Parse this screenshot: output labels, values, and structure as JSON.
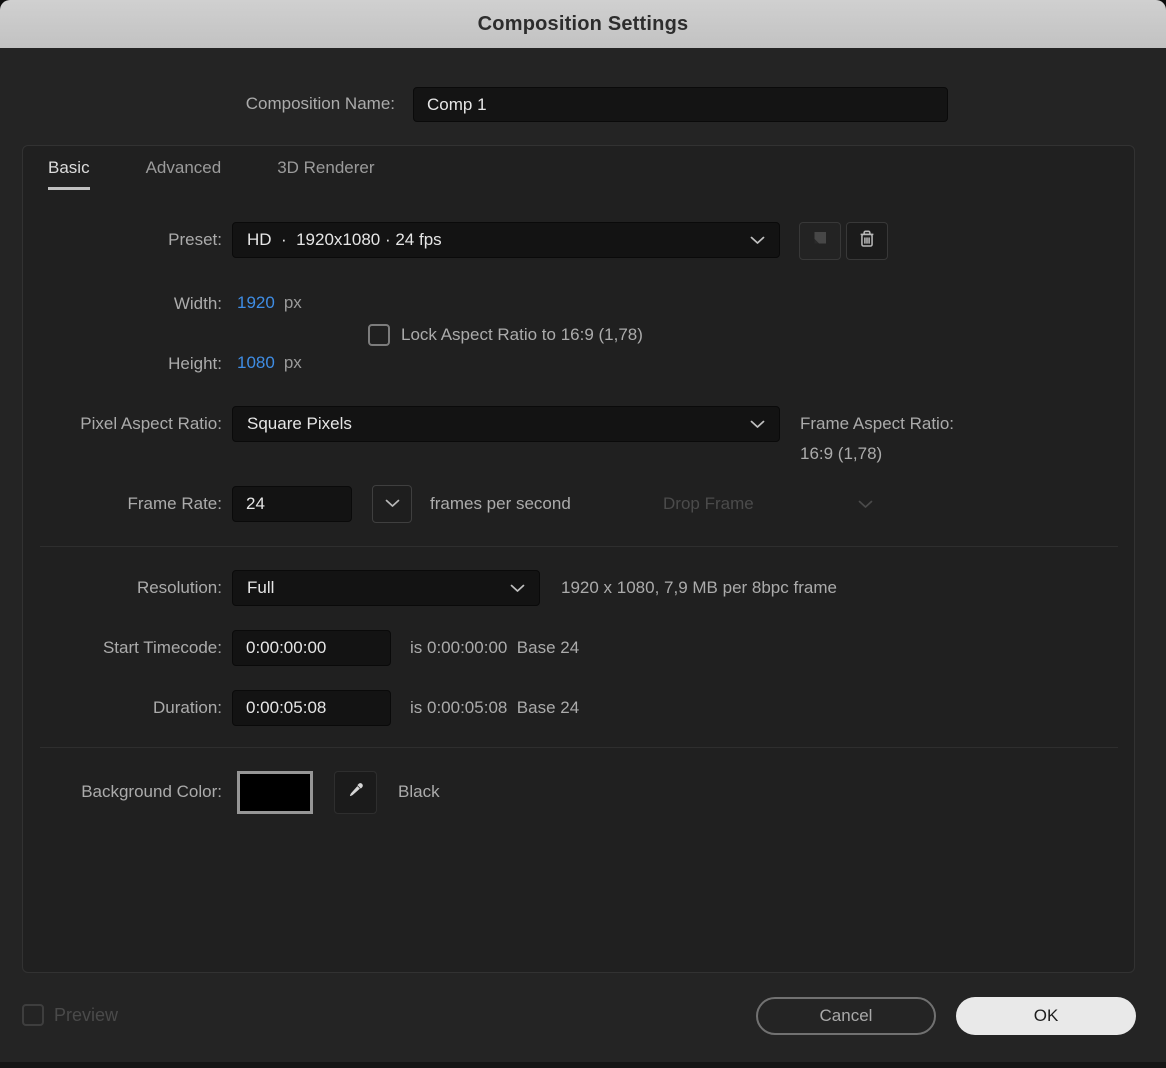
{
  "window": {
    "title": "Composition Settings"
  },
  "composition_name": {
    "label": "Composition Name:",
    "value": "Comp 1"
  },
  "tabs": [
    {
      "label": "Basic",
      "active": true
    },
    {
      "label": "Advanced",
      "active": false
    },
    {
      "label": "3D Renderer",
      "active": false
    }
  ],
  "preset": {
    "label": "Preset:",
    "value": "HD  ·  1920x1080 · 24 fps",
    "save_icon": "save-preset-icon",
    "delete_icon": "trash-icon"
  },
  "dimensions": {
    "width_label": "Width:",
    "width_value": "1920",
    "width_unit": "px",
    "height_label": "Height:",
    "height_value": "1080",
    "height_unit": "px",
    "lock_label": "Lock Aspect Ratio to 16:9 (1,78)",
    "lock_checked": false
  },
  "pixel_aspect_ratio": {
    "label": "Pixel Aspect Ratio:",
    "value": "Square Pixels"
  },
  "frame_aspect_ratio": {
    "label": "Frame Aspect Ratio:",
    "value": "16:9 (1,78)"
  },
  "frame_rate": {
    "label": "Frame Rate:",
    "value": "24",
    "unit": "frames per second",
    "drop_frame_value": "Drop Frame",
    "drop_frame_enabled": false
  },
  "resolution": {
    "label": "Resolution:",
    "value": "Full",
    "info": "1920 x 1080, 7,9 MB per 8bpc frame"
  },
  "start_timecode": {
    "label": "Start Timecode:",
    "value": "0:00:00:00",
    "info": "is 0:00:00:00  Base 24"
  },
  "duration": {
    "label": "Duration:",
    "value": "0:00:05:08",
    "info": "is 0:00:05:08  Base 24"
  },
  "background_color": {
    "label": "Background Color:",
    "swatch_color": "#000000",
    "color_name": "Black"
  },
  "footer": {
    "preview_label": "Preview",
    "preview_checked": false,
    "cancel_label": "Cancel",
    "ok_label": "OK"
  },
  "colors": {
    "accent_blue": "#3f8de4",
    "titlebar_bg": "#c9c9c9",
    "dialog_bg": "#242424",
    "panel_bg": "#202020",
    "field_bg": "#131313",
    "ok_button_bg": "#e9e9e9",
    "swatch_border": "#969696"
  }
}
